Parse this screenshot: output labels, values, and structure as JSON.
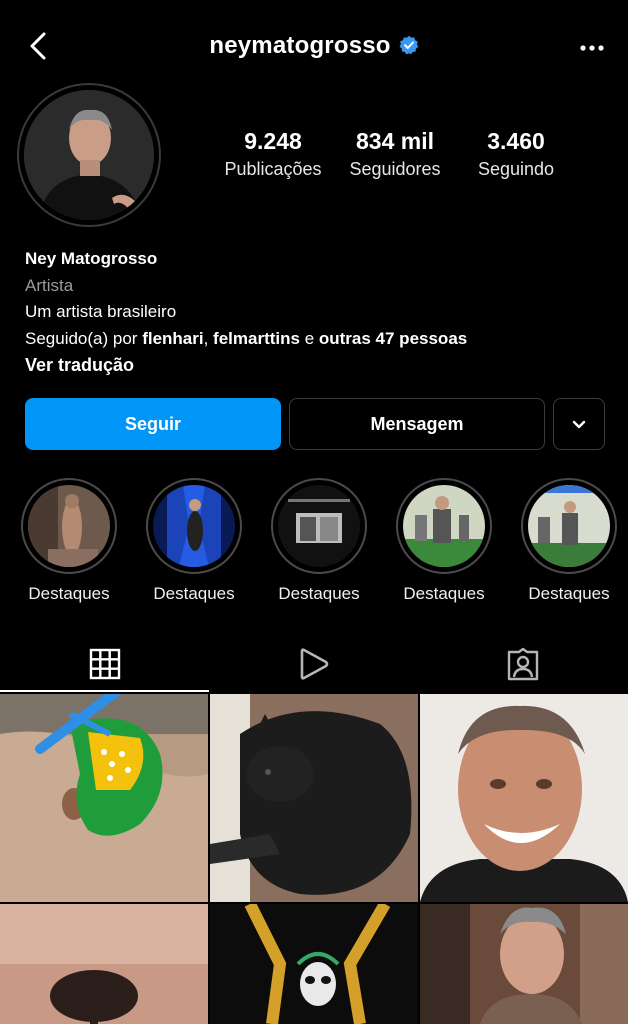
{
  "header": {
    "username": "neymatogrosso",
    "back_icon": "chevron-left-icon",
    "verified_icon": "verified-badge-icon",
    "more_icon": "more-horizontal-icon"
  },
  "stats": [
    {
      "value": "9.248",
      "label": "Publicações"
    },
    {
      "value": "834 mil",
      "label": "Seguidores"
    },
    {
      "value": "3.460",
      "label": "Seguindo"
    }
  ],
  "bio": {
    "name": "Ney Matogrosso",
    "category": "Artista",
    "description": "Um artista brasileiro",
    "followed_prefix": "Seguido(a) por ",
    "followed_user1": "flenhari",
    "followed_sep": ", ",
    "followed_user2": "felmarttins",
    "followed_and": " e ",
    "followed_others": "outras 47 pessoas",
    "translate": "Ver tradução"
  },
  "actions": {
    "follow": "Seguir",
    "message": "Mensagem"
  },
  "highlights": [
    {
      "label": "Destaques"
    },
    {
      "label": "Destaques"
    },
    {
      "label": "Destaques"
    },
    {
      "label": "Destaques"
    },
    {
      "label": "Destaques"
    }
  ],
  "tabs": [
    {
      "name": "grid",
      "icon": "grid-icon",
      "active": true
    },
    {
      "name": "reels",
      "icon": "reels-icon",
      "active": false
    },
    {
      "name": "tagged",
      "icon": "tagged-icon",
      "active": false
    }
  ],
  "colors": {
    "background": "#000000",
    "primary_button": "#0095f6",
    "verified": "#3897f0"
  }
}
